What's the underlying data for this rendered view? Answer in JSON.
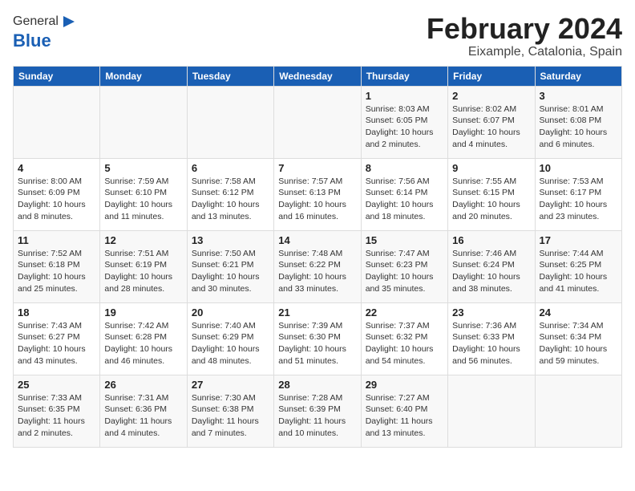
{
  "header": {
    "logo_general": "General",
    "logo_blue": "Blue",
    "month_title": "February 2024",
    "location": "Eixample, Catalonia, Spain"
  },
  "weekdays": [
    "Sunday",
    "Monday",
    "Tuesday",
    "Wednesday",
    "Thursday",
    "Friday",
    "Saturday"
  ],
  "weeks": [
    [
      {
        "day": "",
        "info": ""
      },
      {
        "day": "",
        "info": ""
      },
      {
        "day": "",
        "info": ""
      },
      {
        "day": "",
        "info": ""
      },
      {
        "day": "1",
        "info": "Sunrise: 8:03 AM\nSunset: 6:05 PM\nDaylight: 10 hours\nand 2 minutes."
      },
      {
        "day": "2",
        "info": "Sunrise: 8:02 AM\nSunset: 6:07 PM\nDaylight: 10 hours\nand 4 minutes."
      },
      {
        "day": "3",
        "info": "Sunrise: 8:01 AM\nSunset: 6:08 PM\nDaylight: 10 hours\nand 6 minutes."
      }
    ],
    [
      {
        "day": "4",
        "info": "Sunrise: 8:00 AM\nSunset: 6:09 PM\nDaylight: 10 hours\nand 8 minutes."
      },
      {
        "day": "5",
        "info": "Sunrise: 7:59 AM\nSunset: 6:10 PM\nDaylight: 10 hours\nand 11 minutes."
      },
      {
        "day": "6",
        "info": "Sunrise: 7:58 AM\nSunset: 6:12 PM\nDaylight: 10 hours\nand 13 minutes."
      },
      {
        "day": "7",
        "info": "Sunrise: 7:57 AM\nSunset: 6:13 PM\nDaylight: 10 hours\nand 16 minutes."
      },
      {
        "day": "8",
        "info": "Sunrise: 7:56 AM\nSunset: 6:14 PM\nDaylight: 10 hours\nand 18 minutes."
      },
      {
        "day": "9",
        "info": "Sunrise: 7:55 AM\nSunset: 6:15 PM\nDaylight: 10 hours\nand 20 minutes."
      },
      {
        "day": "10",
        "info": "Sunrise: 7:53 AM\nSunset: 6:17 PM\nDaylight: 10 hours\nand 23 minutes."
      }
    ],
    [
      {
        "day": "11",
        "info": "Sunrise: 7:52 AM\nSunset: 6:18 PM\nDaylight: 10 hours\nand 25 minutes."
      },
      {
        "day": "12",
        "info": "Sunrise: 7:51 AM\nSunset: 6:19 PM\nDaylight: 10 hours\nand 28 minutes."
      },
      {
        "day": "13",
        "info": "Sunrise: 7:50 AM\nSunset: 6:21 PM\nDaylight: 10 hours\nand 30 minutes."
      },
      {
        "day": "14",
        "info": "Sunrise: 7:48 AM\nSunset: 6:22 PM\nDaylight: 10 hours\nand 33 minutes."
      },
      {
        "day": "15",
        "info": "Sunrise: 7:47 AM\nSunset: 6:23 PM\nDaylight: 10 hours\nand 35 minutes."
      },
      {
        "day": "16",
        "info": "Sunrise: 7:46 AM\nSunset: 6:24 PM\nDaylight: 10 hours\nand 38 minutes."
      },
      {
        "day": "17",
        "info": "Sunrise: 7:44 AM\nSunset: 6:25 PM\nDaylight: 10 hours\nand 41 minutes."
      }
    ],
    [
      {
        "day": "18",
        "info": "Sunrise: 7:43 AM\nSunset: 6:27 PM\nDaylight: 10 hours\nand 43 minutes."
      },
      {
        "day": "19",
        "info": "Sunrise: 7:42 AM\nSunset: 6:28 PM\nDaylight: 10 hours\nand 46 minutes."
      },
      {
        "day": "20",
        "info": "Sunrise: 7:40 AM\nSunset: 6:29 PM\nDaylight: 10 hours\nand 48 minutes."
      },
      {
        "day": "21",
        "info": "Sunrise: 7:39 AM\nSunset: 6:30 PM\nDaylight: 10 hours\nand 51 minutes."
      },
      {
        "day": "22",
        "info": "Sunrise: 7:37 AM\nSunset: 6:32 PM\nDaylight: 10 hours\nand 54 minutes."
      },
      {
        "day": "23",
        "info": "Sunrise: 7:36 AM\nSunset: 6:33 PM\nDaylight: 10 hours\nand 56 minutes."
      },
      {
        "day": "24",
        "info": "Sunrise: 7:34 AM\nSunset: 6:34 PM\nDaylight: 10 hours\nand 59 minutes."
      }
    ],
    [
      {
        "day": "25",
        "info": "Sunrise: 7:33 AM\nSunset: 6:35 PM\nDaylight: 11 hours\nand 2 minutes."
      },
      {
        "day": "26",
        "info": "Sunrise: 7:31 AM\nSunset: 6:36 PM\nDaylight: 11 hours\nand 4 minutes."
      },
      {
        "day": "27",
        "info": "Sunrise: 7:30 AM\nSunset: 6:38 PM\nDaylight: 11 hours\nand 7 minutes."
      },
      {
        "day": "28",
        "info": "Sunrise: 7:28 AM\nSunset: 6:39 PM\nDaylight: 11 hours\nand 10 minutes."
      },
      {
        "day": "29",
        "info": "Sunrise: 7:27 AM\nSunset: 6:40 PM\nDaylight: 11 hours\nand 13 minutes."
      },
      {
        "day": "",
        "info": ""
      },
      {
        "day": "",
        "info": ""
      }
    ]
  ]
}
